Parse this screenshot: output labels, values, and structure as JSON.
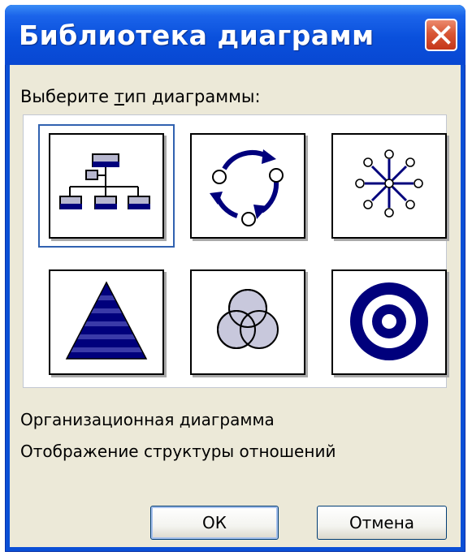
{
  "window": {
    "title": "Библиотека диаграмм",
    "close_icon": "close-icon"
  },
  "prompt": {
    "before": "Выберите ",
    "underlined": "т",
    "after": "ип диаграммы:"
  },
  "diagram_types": [
    {
      "icon": "org-chart-icon",
      "selected": true
    },
    {
      "icon": "cycle-diagram-icon",
      "selected": false
    },
    {
      "icon": "radial-diagram-icon",
      "selected": false
    },
    {
      "icon": "pyramid-diagram-icon",
      "selected": false
    },
    {
      "icon": "venn-diagram-icon",
      "selected": false
    },
    {
      "icon": "target-diagram-icon",
      "selected": false
    }
  ],
  "description": {
    "name": "Организационная диаграмма",
    "detail": "Отображение структуры отношений"
  },
  "buttons": {
    "ok_label": "ОК",
    "cancel_label": "Отмена"
  },
  "colors": {
    "titlebar": "#0a50dc",
    "dialog_face": "#ece9d8",
    "icon_navy": "#00007c",
    "icon_light": "#c8c8dc"
  }
}
